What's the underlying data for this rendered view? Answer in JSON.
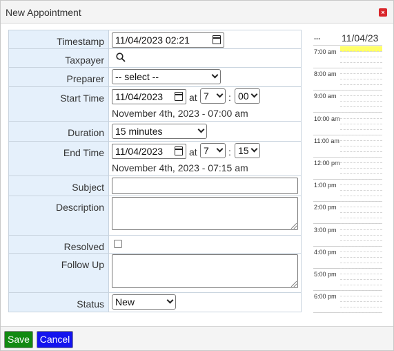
{
  "dialog": {
    "title": "New Appointment",
    "close_glyph": "×"
  },
  "form": {
    "timestamp": {
      "label": "Timestamp",
      "value": "11/04/2023 02:21"
    },
    "taxpayer": {
      "label": "Taxpayer",
      "icon": "search-icon"
    },
    "preparer": {
      "label": "Preparer",
      "selected": "-- select --"
    },
    "start_time": {
      "label": "Start Time",
      "date": "11/04/2023",
      "at": "at",
      "hour": "7",
      "colon": ":",
      "minute": "00",
      "summary": "November 4th, 2023 - 07:00 am"
    },
    "duration": {
      "label": "Duration",
      "selected": "15 minutes"
    },
    "end_time": {
      "label": "End Time",
      "date": "11/04/2023",
      "at": "at",
      "hour": "7",
      "colon": ":",
      "minute": "15",
      "summary": "November 4th, 2023 - 07:15 am"
    },
    "subject": {
      "label": "Subject",
      "value": ""
    },
    "description": {
      "label": "Description",
      "value": ""
    },
    "resolved": {
      "label": "Resolved",
      "checked": false
    },
    "follow_up": {
      "label": "Follow Up",
      "value": ""
    },
    "status": {
      "label": "Status",
      "selected": "New"
    }
  },
  "calendar": {
    "nav": "...",
    "date": "11/04/23",
    "hours": [
      "7:00 am",
      "8:00 am",
      "9:00 am",
      "10:00 am",
      "11:00 am",
      "12:00 pm",
      "1:00 pm",
      "2:00 pm",
      "3:00 pm",
      "4:00 pm",
      "5:00 pm",
      "6:00 pm"
    ],
    "highlight_color": "#ffff66"
  },
  "footer": {
    "save_label": "Save",
    "cancel_label": "Cancel"
  },
  "colors": {
    "label_bg": "#e5f0fb",
    "save": "#118a11",
    "cancel": "#1414ee",
    "close": "#d9262b"
  }
}
